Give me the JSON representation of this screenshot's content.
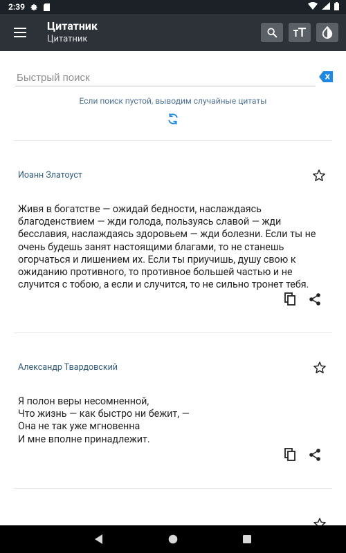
{
  "status_bar": {
    "time": "2:39",
    "icons": [
      "gear-icon",
      "sd-card-icon",
      "wifi-icon",
      "signal-icon",
      "battery-icon"
    ]
  },
  "app_bar": {
    "title": "Цитатник",
    "subtitle": "Цитатник",
    "actions": [
      "search-icon",
      "text-size-icon",
      "contrast-icon"
    ]
  },
  "search": {
    "placeholder": "Быстрый поиск",
    "value": "",
    "hint": "Если поиск пустой, выводим случайные цитаты"
  },
  "quotes": [
    {
      "author": "Иоанн Златоуст",
      "text": "Живя в богатстве — ожидай бедности, наслаждаясь благоденствием — жди голода, пользуясь славой — жди бесславия, наслаждаясь здоровьем — жди болезни. Если ты не очень будешь занят настоящими благами, то не станешь огорчаться и лишением их. Если ты приучишь, душу свою к ожиданию противного, то противное большей частью и не случится с тобою, а если и случится, то не сильно тронет тебя."
    },
    {
      "author": "Александр Твардовский",
      "text": "Я полон веры несомненной,\nЧто жизнь — как быстро ни бежит, —\nОна не так уже мгновенна\nИ мне вполне принадлежит."
    }
  ],
  "colors": {
    "status_bar": "#1c2127",
    "app_bar": "#2d3238",
    "accent": "#1e88e5",
    "author": "#2f5a7c"
  }
}
